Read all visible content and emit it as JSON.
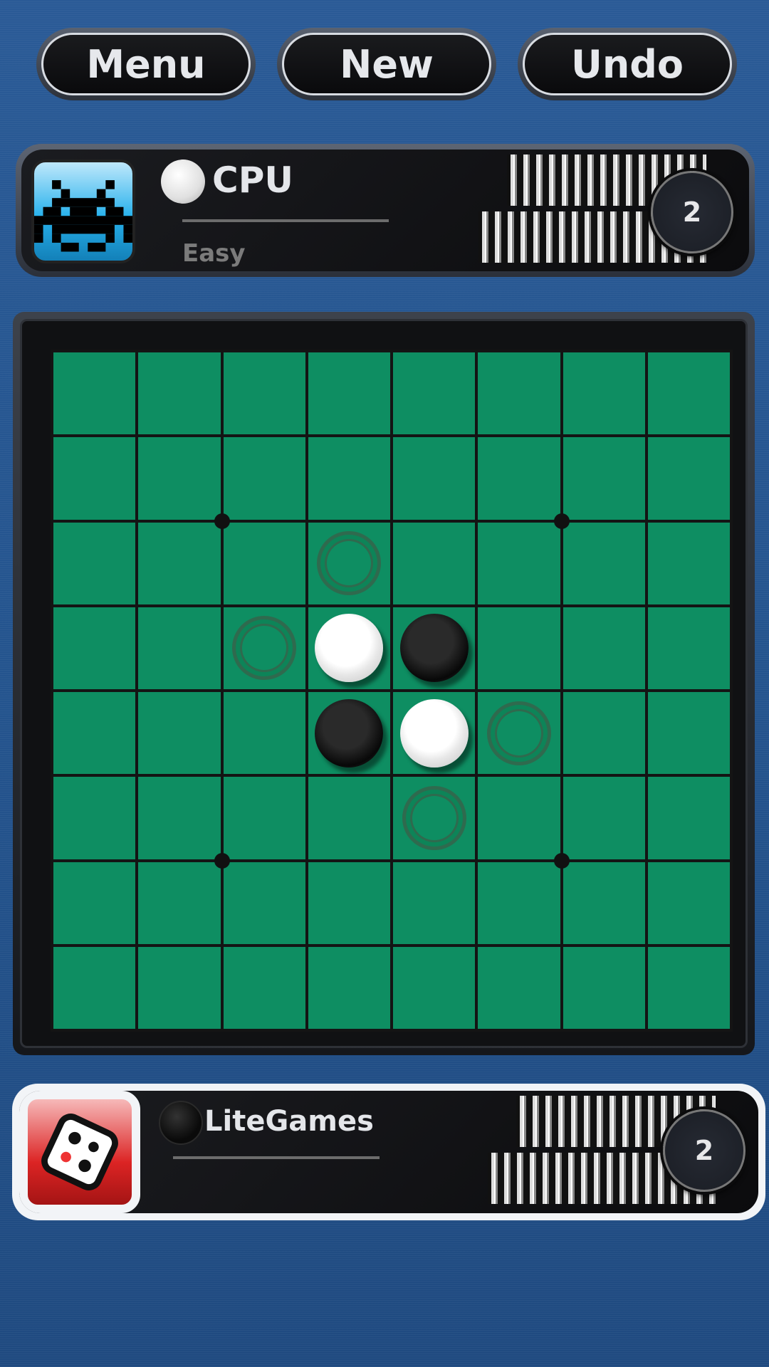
{
  "toolbar": {
    "menu": "Menu",
    "new": "New",
    "undo": "Undo"
  },
  "opponent": {
    "name": "CPU",
    "level": "Easy",
    "color": "white",
    "score": "2",
    "avatar_icon": "space-invader-icon",
    "avatar_color": "#27b1ec"
  },
  "player": {
    "name": "LiteGames",
    "color": "black",
    "score": "2",
    "avatar_icon": "dice-icon",
    "avatar_color": "#dc2424",
    "active": true
  },
  "board": {
    "cell_color": "#0e8e62",
    "rows": [
      "........",
      "........",
      "...h....",
      "..hWB...",
      "...BWh..",
      "....h...",
      "........",
      "........"
    ],
    "legend": {
      "W": "white",
      "B": "black",
      "h": "legal-move-hint"
    }
  }
}
